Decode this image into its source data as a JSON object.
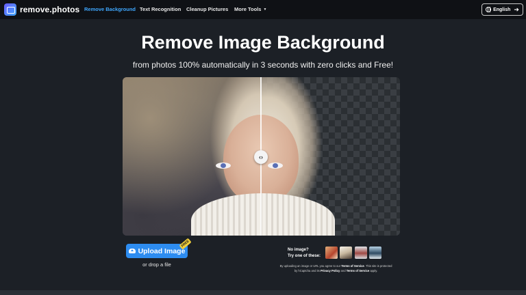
{
  "nav": {
    "brand": "remove.photos",
    "links": [
      {
        "label": "Remove Background",
        "active": true
      },
      {
        "label": "Text Recognition",
        "active": false
      },
      {
        "label": "Cleanup Pictures",
        "active": false
      },
      {
        "label": "More Tools",
        "active": false
      }
    ],
    "language": "English",
    "language_icon": "globe-icon",
    "language_arrow_icon": "arrow-right-icon"
  },
  "hero": {
    "title": "Remove Image Background",
    "subtitle": "from photos 100% automatically in 3 seconds with zero clicks and Free!"
  },
  "compare": {
    "handle_glyph": "‹›"
  },
  "upload": {
    "button_label": "Upload Image",
    "badge": "FREE",
    "drop_text": "or drop a file"
  },
  "samples": {
    "line1": "No image?",
    "line2": "Try one of these:"
  },
  "terms": {
    "prefix": "By uploading an image or URL you agree to our",
    "tos": "Terms of Service",
    "middle": ". This site is protected by hCaptcha and its",
    "privacy": "Privacy Policy",
    "and": "and",
    "tos2": "Terms of Service",
    "suffix": "apply."
  },
  "colors": {
    "background": "#1c2026",
    "nav_background": "#0f1115",
    "accent": "#2d8cf0",
    "active_link": "#3fa8ff"
  }
}
